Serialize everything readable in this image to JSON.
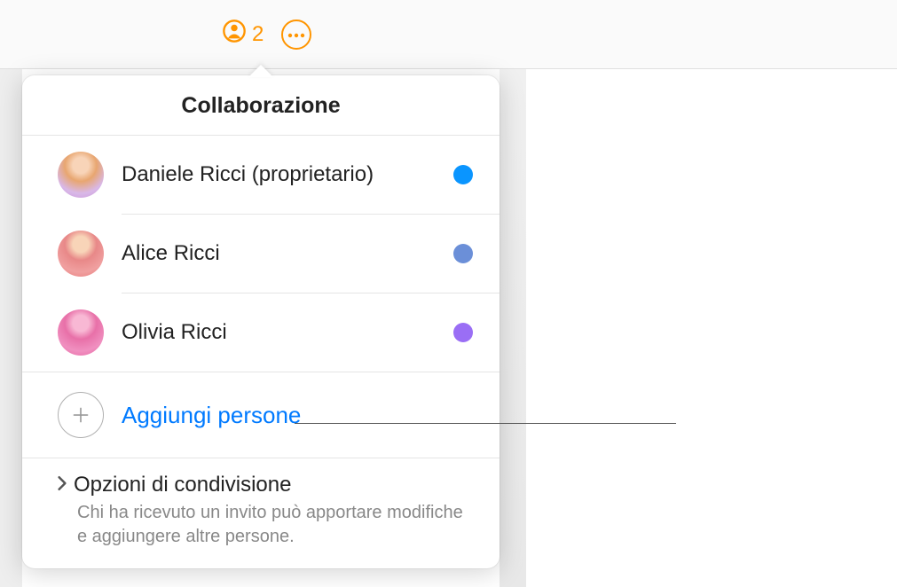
{
  "toolbar": {
    "collab_count": "2"
  },
  "popover": {
    "title": "Collaborazione",
    "participants": [
      {
        "name": "Daniele Ricci (proprietario)",
        "color": "#0a95ff"
      },
      {
        "name": "Alice Ricci",
        "color": "#6b8fd8"
      },
      {
        "name": "Olivia Ricci",
        "color": "#9a6ef5"
      }
    ],
    "add_label": "Aggiungi persone",
    "options": {
      "title": "Opzioni di condivisione",
      "subtitle": "Chi ha ricevuto un invito può apportare modifiche e aggiungere altre persone."
    }
  }
}
